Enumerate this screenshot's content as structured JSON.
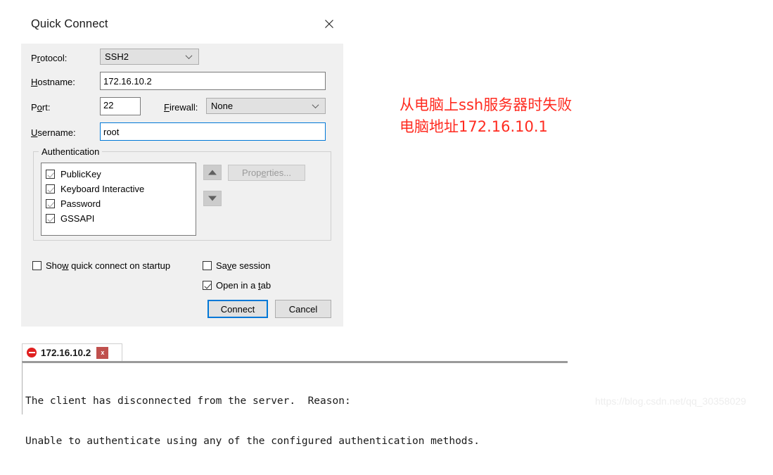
{
  "dialog": {
    "title": "Quick Connect",
    "close_icon": "close-icon",
    "fields": {
      "protocol_label_pre": "P",
      "protocol_label_mn": "r",
      "protocol_label_post": "otocol:",
      "protocol_value": "SSH2",
      "hostname_label_pre": "",
      "hostname_label_mn": "H",
      "hostname_label_post": "ostname:",
      "hostname_value": "172.16.10.2",
      "port_label_pre": "P",
      "port_label_mn": "o",
      "port_label_post": "rt:",
      "port_value": "22",
      "firewall_label_pre": "",
      "firewall_label_mn": "F",
      "firewall_label_post": "irewall:",
      "firewall_value": "None",
      "username_label_pre": "",
      "username_label_mn": "U",
      "username_label_post": "sername:",
      "username_value": "root"
    },
    "authentication": {
      "group_label": "Authentication",
      "items": [
        {
          "label": "PublicKey",
          "checked": true
        },
        {
          "label": "Keyboard Interactive",
          "checked": true
        },
        {
          "label": "Password",
          "checked": true
        },
        {
          "label": "GSSAPI",
          "checked": true
        }
      ],
      "move_up_icon": "arrow-up-icon",
      "move_down_icon": "arrow-down-icon",
      "properties_pre": "Prop",
      "properties_mn": "e",
      "properties_post": "rties...",
      "properties_enabled": false
    },
    "options": {
      "show_on_startup_pre": "Sho",
      "show_on_startup_mn": "w",
      "show_on_startup_post": " quick connect on startup",
      "show_on_startup_checked": false,
      "save_session_pre": "Sa",
      "save_session_mn": "v",
      "save_session_post": "e session",
      "save_session_checked": false,
      "open_in_tab_pre": "Open in a ",
      "open_in_tab_mn": "t",
      "open_in_tab_post": "ab",
      "open_in_tab_checked": true
    },
    "buttons": {
      "connect": "Connect",
      "cancel": "Cancel"
    }
  },
  "annotation": {
    "line1": "从电脑上ssh服务器时失败",
    "line2": "电脑地址172.16.10.1",
    "color": "#ff2b20"
  },
  "terminal": {
    "tab_label": "172.16.10.2",
    "tab_status_icon": "disconnected-icon",
    "tab_close_label": "x",
    "output_line1": "The client has disconnected from the server.  Reason:",
    "output_line2": "Unable to authenticate using any of the configured authentication methods."
  },
  "watermark": "https://blog.csdn.net/qq_30358029",
  "colors": {
    "accent": "#0078d7",
    "dialog_bg": "#f0f0f0",
    "annotation_red": "#ff2b20",
    "tab_close_red": "#c0504d"
  }
}
